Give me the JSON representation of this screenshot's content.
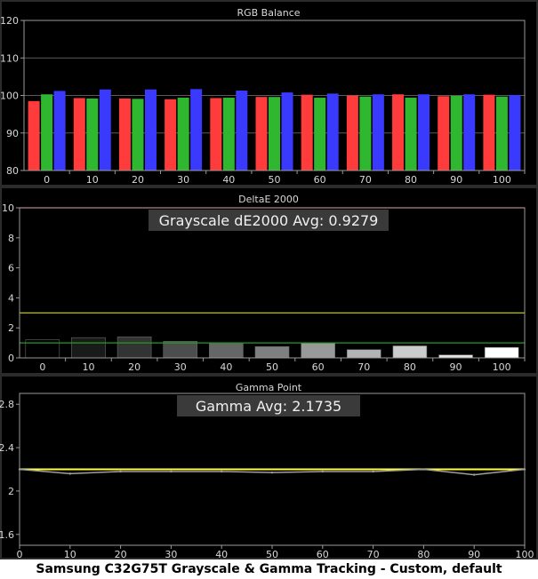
{
  "caption": "Samsung C32G75T Grayscale & Gamma Tracking - Custom, default",
  "colors": {
    "background": "#000000",
    "frame": "#2b2b2b",
    "plot_border": "#9a9a9a",
    "grid": "#5a5a5a",
    "text": "#d8d8d8",
    "red": "#ff3b3b",
    "green": "#2fb82f",
    "blue": "#3a3aff",
    "target_line_red": "#ff3030",
    "threshold_line_yellow": "#d8d800",
    "threshold_line_green": "#1fa01f",
    "gamma_target": "#ffff40",
    "gamma_measured": "#a0a0a0"
  },
  "chart_data": [
    {
      "type": "bar",
      "title": "RGB Balance",
      "categories": [
        "0",
        "10",
        "20",
        "30",
        "40",
        "50",
        "60",
        "70",
        "80",
        "90",
        "100"
      ],
      "series": [
        {
          "color": "red",
          "values": [
            98.5,
            99.3,
            99.2,
            99.0,
            99.3,
            99.6,
            100.2,
            100.0,
            100.3,
            99.8,
            100.2
          ]
        },
        {
          "color": "green",
          "values": [
            100.3,
            99.2,
            99.1,
            99.4,
            99.4,
            99.6,
            99.4,
            99.7,
            99.4,
            99.9,
            99.7
          ]
        },
        {
          "color": "blue",
          "values": [
            101.2,
            101.6,
            101.6,
            101.7,
            101.3,
            100.8,
            100.5,
            100.3,
            100.3,
            100.3,
            100.1
          ]
        }
      ],
      "ylim": [
        80,
        120
      ],
      "yticks": [
        "80",
        "90",
        "100",
        "110",
        "120"
      ],
      "grid": true
    },
    {
      "type": "bar",
      "title": "DeltaE 2000",
      "annotation": "Grayscale dE2000 Avg: 0.9279",
      "categories": [
        "0",
        "10",
        "20",
        "30",
        "40",
        "50",
        "60",
        "70",
        "80",
        "90",
        "100"
      ],
      "values": [
        1.2,
        1.35,
        1.4,
        1.1,
        0.95,
        0.75,
        1.0,
        0.55,
        0.8,
        0.2,
        0.7
      ],
      "bar_gray_levels": [
        0,
        10,
        20,
        30,
        40,
        50,
        60,
        70,
        80,
        90,
        100
      ],
      "reference_lines": [
        10,
        3,
        1
      ],
      "ylim": [
        0,
        10
      ],
      "yticks": [
        "0",
        "2",
        "4",
        "6",
        "8",
        "10"
      ],
      "grid": false
    },
    {
      "type": "line",
      "title": "Gamma Point",
      "annotation": "Gamma Avg: 2.1735",
      "x": [
        0,
        10,
        20,
        30,
        40,
        50,
        60,
        70,
        80,
        90,
        100
      ],
      "target": 2.2,
      "values": [
        2.2,
        2.16,
        2.18,
        2.18,
        2.18,
        2.17,
        2.18,
        2.18,
        2.2,
        2.15,
        2.2
      ],
      "xlim": [
        0,
        100
      ],
      "xticks": [
        "0",
        "10",
        "20",
        "30",
        "40",
        "50",
        "60",
        "70",
        "80",
        "90",
        "100"
      ],
      "ylim": [
        1.5,
        2.9
      ],
      "yticks": [
        "1.6",
        "2",
        "2.4",
        "2.8"
      ],
      "grid": false
    }
  ]
}
